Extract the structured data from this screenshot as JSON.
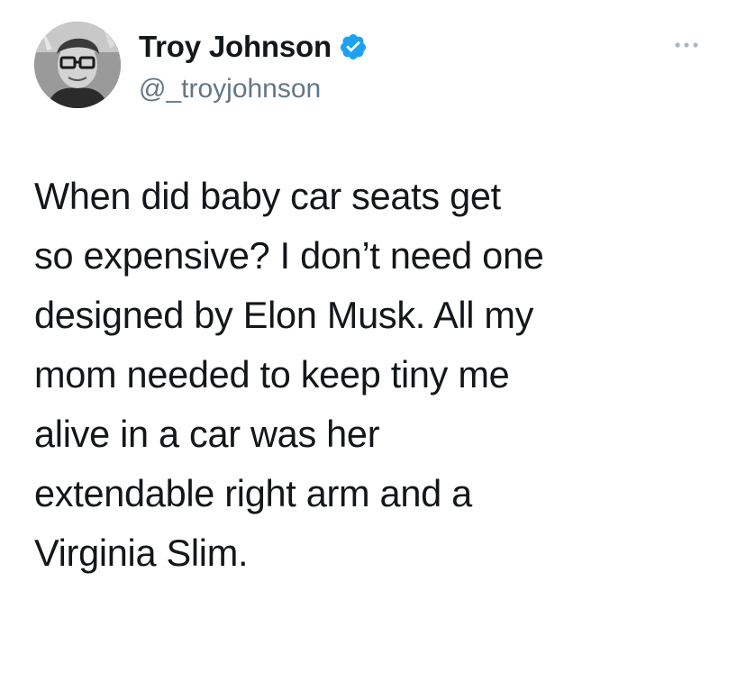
{
  "tweet": {
    "author": {
      "display_name": "Troy Johnson",
      "handle": "@_troyjohnson",
      "verified": true,
      "avatar_icon": "profile-photo",
      "verified_icon": "verified-badge-icon",
      "verified_color": "#1da1f2"
    },
    "more_icon": "more-options-icon",
    "text_lines": [
      "When did baby car seats get",
      "so expensive? I don’t need one",
      "designed by Elon Musk. All my",
      "mom needed to keep tiny me",
      "alive in a car was her",
      "extendable right arm and a",
      "Virginia Slim."
    ]
  },
  "colors": {
    "background": "#ffffff",
    "text": "#14171a",
    "secondary_text": "#657786",
    "accent": "#1da1f2"
  }
}
